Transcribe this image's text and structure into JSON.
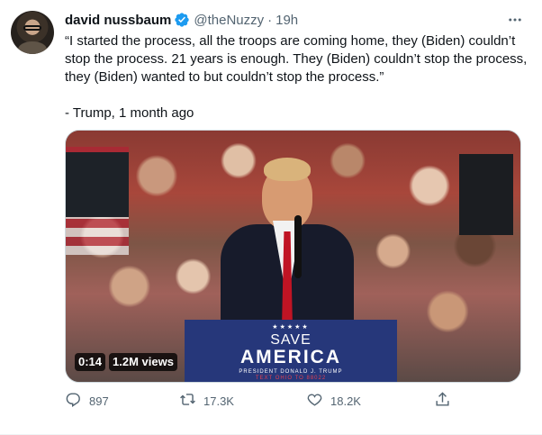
{
  "tweet": {
    "author": {
      "name": "david nussbaum",
      "handle": "@theNuzzy",
      "separator": "·",
      "time": "19h",
      "verified": true
    },
    "text": [
      "“I started the process, all the troops are coming home, they (Biden) couldn’t stop the process. 21 years is enough. They (Biden) couldn’t stop the process, they (Biden) wanted to but couldn’t stop the process.”",
      "- Trump, 1 month ago"
    ],
    "media": {
      "duration": "0:14",
      "views": "1.2M views",
      "podium": {
        "stars": "★★★★★",
        "line1": "SAVE",
        "line2": "AMERICA",
        "line3": "PRESIDENT DONALD J. TRUMP",
        "line4": "TEXT OHIO TO 88022"
      }
    },
    "metrics": {
      "replies": "897",
      "retweets": "17.3K",
      "likes": "18.2K"
    },
    "icons": {
      "more": "more-icon",
      "reply": "reply-icon",
      "retweet": "retweet-icon",
      "like": "heart-icon",
      "share": "share-icon"
    },
    "colors": {
      "verified": "#1d9bf0",
      "muted": "#536471",
      "text": "#0f1419"
    }
  }
}
